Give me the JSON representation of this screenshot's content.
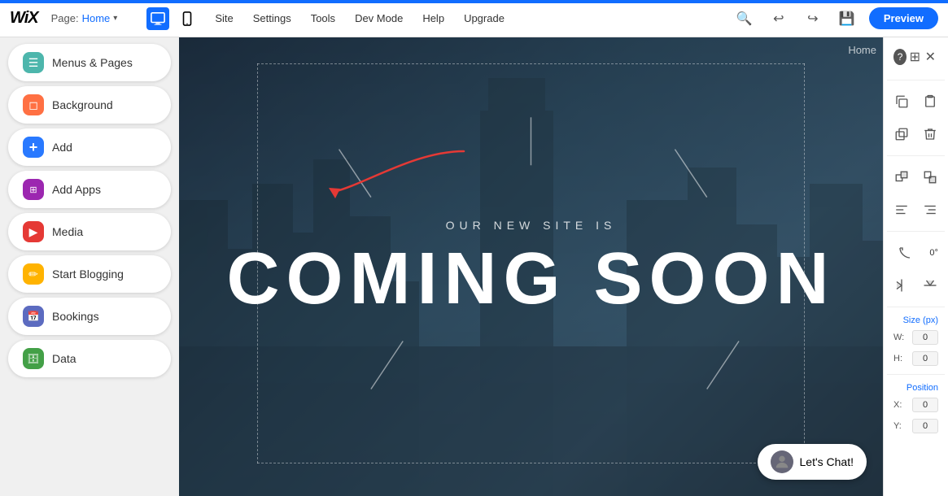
{
  "topNav": {
    "logo": "WiX",
    "pageLabel": "Page:",
    "pageName": "Home",
    "navLinks": [
      "Site",
      "Settings",
      "Tools",
      "Dev Mode",
      "Help",
      "Upgrade"
    ],
    "previewLabel": "Preview",
    "blueBar": true
  },
  "sidebar": {
    "items": [
      {
        "id": "menus-pages",
        "label": "Menus & Pages",
        "iconClass": "icon-teal",
        "iconSymbol": "☰"
      },
      {
        "id": "background",
        "label": "Background",
        "iconClass": "icon-orange",
        "iconSymbol": "◻"
      },
      {
        "id": "add",
        "label": "Add",
        "iconClass": "icon-blue",
        "iconSymbol": "+"
      },
      {
        "id": "add-apps",
        "label": "Add Apps",
        "iconClass": "icon-purple",
        "iconSymbol": "⊞"
      },
      {
        "id": "media",
        "label": "Media",
        "iconClass": "icon-red",
        "iconSymbol": "▶"
      },
      {
        "id": "start-blogging",
        "label": "Start Blogging",
        "iconClass": "icon-yellow",
        "iconSymbol": "✏"
      },
      {
        "id": "bookings",
        "label": "Bookings",
        "iconClass": "icon-indigo",
        "iconSymbol": "📅"
      },
      {
        "id": "data",
        "label": "Data",
        "iconClass": "icon-green",
        "iconSymbol": "⚡"
      }
    ]
  },
  "canvas": {
    "homeLabel": "Home",
    "siteText": "OUR NEW SITE IS",
    "comingSoon": "COMING SOON"
  },
  "rightPanel": {
    "helpLabel": "?",
    "sizeLabel": "Size (px)",
    "wLabel": "W:",
    "wValue": "0",
    "hLabel": "H:",
    "hValue": "0",
    "positionLabel": "Position",
    "xLabel": "X:",
    "xValue": "0",
    "yLabel": "Y:",
    "yValue": "0",
    "rotateValue": "0°"
  },
  "chat": {
    "label": "Let's Chat!"
  }
}
